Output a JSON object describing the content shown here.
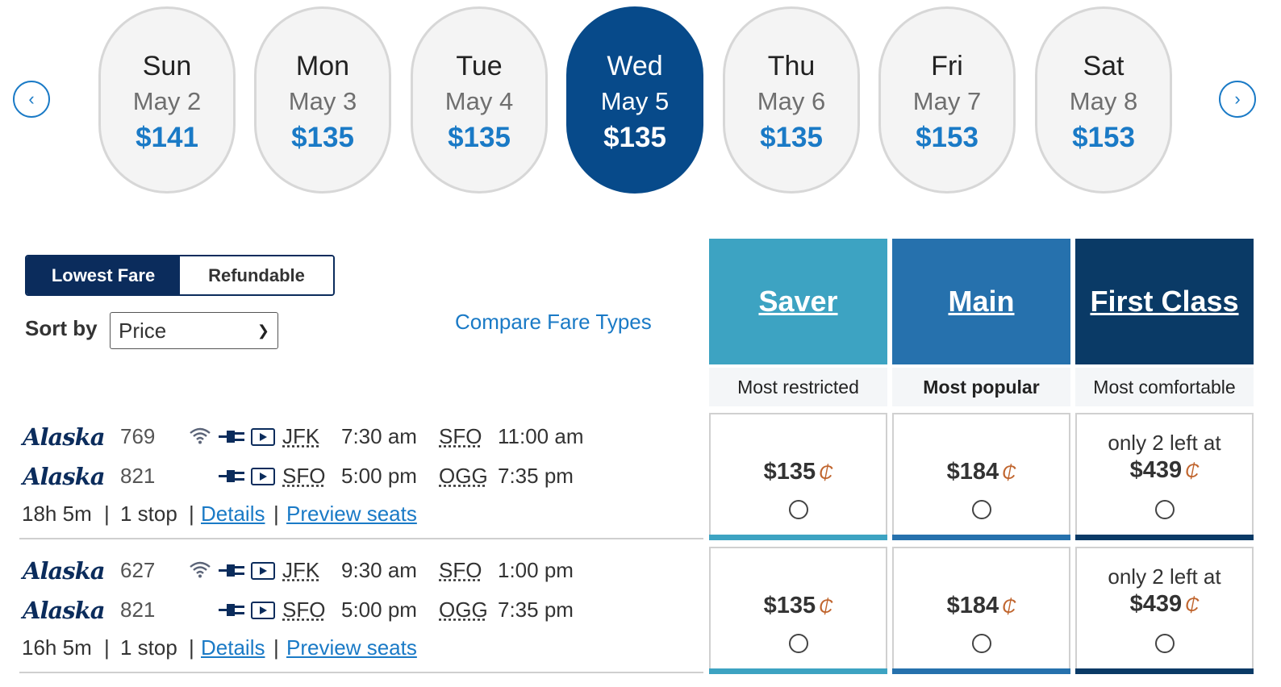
{
  "carousel": {
    "prev_icon": "‹",
    "next_icon": "›",
    "days": [
      {
        "day": "Sun",
        "date": "May 2",
        "price": "$141",
        "selected": false
      },
      {
        "day": "Mon",
        "date": "May 3",
        "price": "$135",
        "selected": false
      },
      {
        "day": "Tue",
        "date": "May 4",
        "price": "$135",
        "selected": false
      },
      {
        "day": "Wed",
        "date": "May 5",
        "price": "$135",
        "selected": true
      },
      {
        "day": "Thu",
        "date": "May 6",
        "price": "$135",
        "selected": false
      },
      {
        "day": "Fri",
        "date": "May 7",
        "price": "$153",
        "selected": false
      },
      {
        "day": "Sat",
        "date": "May 8",
        "price": "$153",
        "selected": false
      }
    ]
  },
  "controls": {
    "toggle_lowest": "Lowest Fare",
    "toggle_refundable": "Refundable",
    "sort_label": "Sort by",
    "sort_value": "Price",
    "compare_link": "Compare Fare Types"
  },
  "fare_types": [
    {
      "name": "Saver",
      "subtitle": "Most restricted",
      "color": "#3da3c2"
    },
    {
      "name": "Main",
      "subtitle": "Most popular",
      "color": "#2671ad"
    },
    {
      "name": "First Class",
      "subtitle": "Most comfortable",
      "color": "#0a3a66"
    }
  ],
  "flights": [
    {
      "segments": [
        {
          "airline": "Alaska",
          "number": "769",
          "wifi": true,
          "from": "JFK",
          "depart": "7:30 am",
          "to": "SFO",
          "arrive": "11:00 am"
        },
        {
          "airline": "Alaska",
          "number": "821",
          "wifi": false,
          "from": "SFO",
          "depart": "5:00 pm",
          "to": "OGG",
          "arrive": "7:35 pm"
        }
      ],
      "duration": "18h 5m",
      "stops": "1 stop",
      "details": "Details",
      "preview": "Preview seats",
      "fares": [
        {
          "note": "",
          "price": "$135"
        },
        {
          "note": "",
          "price": "$184"
        },
        {
          "note": "only 2 left at",
          "price": "$439"
        }
      ]
    },
    {
      "segments": [
        {
          "airline": "Alaska",
          "number": "627",
          "wifi": true,
          "from": "JFK",
          "depart": "9:30 am",
          "to": "SFO",
          "arrive": "1:00 pm"
        },
        {
          "airline": "Alaska",
          "number": "821",
          "wifi": false,
          "from": "SFO",
          "depart": "5:00 pm",
          "to": "OGG",
          "arrive": "7:35 pm"
        }
      ],
      "duration": "16h 5m",
      "stops": "1 stop",
      "details": "Details",
      "preview": "Preview seats",
      "fares": [
        {
          "note": "",
          "price": "$135"
        },
        {
          "note": "",
          "price": "$184"
        },
        {
          "note": "only 2 left at",
          "price": "$439"
        }
      ]
    }
  ],
  "icons": {
    "wifi": "wifi-icon",
    "power": "power-plug-icon",
    "entertainment": "video-play-icon",
    "mileage": "mileage-plan-icon"
  }
}
